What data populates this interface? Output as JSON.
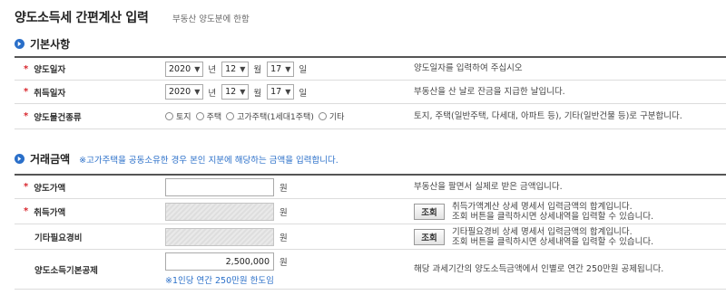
{
  "title": "양도소득세 간편계산 입력",
  "subtitle": "부동산 양도분에 한함",
  "basic": {
    "heading": "기본사항",
    "rows": [
      {
        "label": "양도일자",
        "year": "2020",
        "year_unit": "년",
        "month": "12",
        "month_unit": "월",
        "day": "17",
        "day_unit": "일",
        "desc": "양도일자를 입력하여 주십시오"
      },
      {
        "label": "취득일자",
        "year": "2020",
        "year_unit": "년",
        "month": "12",
        "month_unit": "월",
        "day": "17",
        "day_unit": "일",
        "desc": "부동산을 산 날로 잔금을 지급한 날입니다."
      }
    ],
    "type_row": {
      "label": "양도물건종류",
      "options": [
        "토지",
        "주택",
        "고가주택(1세대1주택)",
        "기타"
      ],
      "desc": "토지, 주택(일반주택, 다세대, 아파트 등), 기타(일반건물 등)로 구분합니다."
    }
  },
  "trade": {
    "heading": "거래금액",
    "note": "※고가주택을 공동소유한 경우 본인 지분에 해당하는 금액을 입력합니다.",
    "unit": "원",
    "sale_price": {
      "label": "양도가액",
      "value": "",
      "desc": "부동산을 팔면서 실제로 받은 금액입니다."
    },
    "acq_price": {
      "label": "취득가액",
      "value": "",
      "button": "조회",
      "desc1": "취득가액계산 상세 명세서 입력금액의 합계입니다.",
      "desc2": "조회 버튼을 클릭하시면 상세내역을 입력할 수 있습니다."
    },
    "expense": {
      "label": "기타필요경비",
      "value": "",
      "button": "조회",
      "desc1": "기타필요경비 상세 명세서 입력금액의 합계입니다.",
      "desc2": "조회 버튼을 클릭하시면 상세내역을 입력할 수 있습니다."
    },
    "deduction": {
      "label": "양도소득기본공제",
      "value": "2,500,000",
      "note": "※1인당 연간 250만원 한도임",
      "desc": "해당 과세기간의 양도소득금액에서 인별로 연간 250만원 공제됩니다."
    }
  }
}
